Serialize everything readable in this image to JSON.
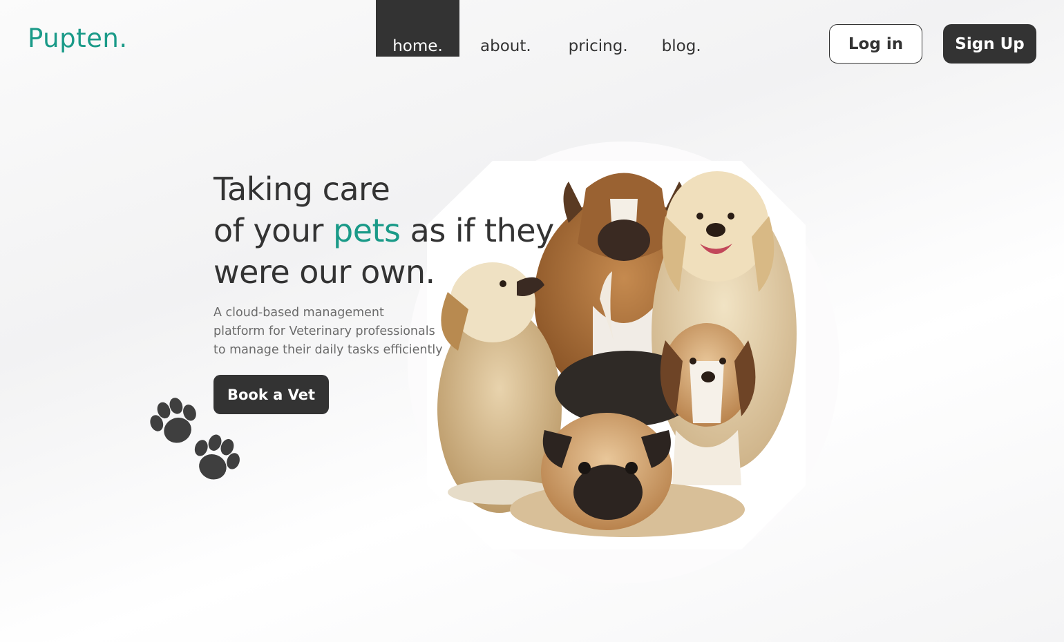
{
  "brand": {
    "logo_text": "Pupten.",
    "accent_color": "#1a9a88"
  },
  "nav": {
    "items": [
      {
        "label": "home.",
        "active": true
      },
      {
        "label": "about.",
        "active": false
      },
      {
        "label": "pricing.",
        "active": false
      },
      {
        "label": "blog.",
        "active": false
      }
    ]
  },
  "auth": {
    "login_label": "Log in",
    "signup_label": "Sign Up"
  },
  "hero": {
    "headline_line1": "Taking care",
    "headline_line2_pre": "of your ",
    "headline_accent": "pets",
    "headline_line2_post": " as if they",
    "headline_line3": "were our own.",
    "subtitle_lines": [
      "A cloud-based management",
      "platform for Veterinary professionals",
      "to manage their daily tasks efficiently"
    ],
    "cta_label": "Book a Vet",
    "image": "group-of-dogs-photo",
    "decoration_icon": "paw-prints-icon"
  },
  "colors": {
    "dark": "#333333",
    "accent": "#1a9a88",
    "muted_text": "#6b6b6b"
  }
}
